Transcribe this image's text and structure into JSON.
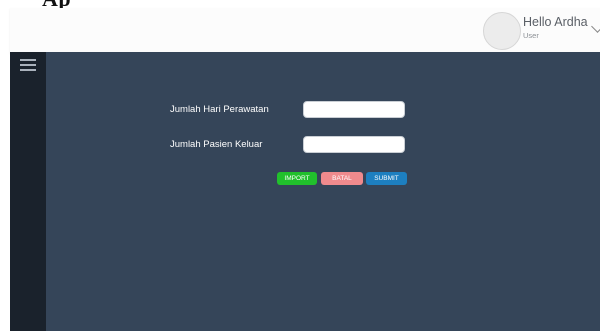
{
  "page": {
    "cut_title": "Ap"
  },
  "header": {
    "user_name": "Hello Ardha",
    "user_role": "User"
  },
  "form": {
    "field_1_label": "Jumlah Hari Perawatan",
    "field_1_value": "",
    "field_2_label": "Jumlah Pasien Keluar",
    "field_2_value": ""
  },
  "buttons": {
    "import_label": "IMPORT",
    "batal_label": "BATAL",
    "submit_label": "SUBMIT"
  },
  "colors": {
    "sidebar_bg": "#1a222c",
    "main_bg": "#354559",
    "import": "#21c02c",
    "batal": "#f08a8d",
    "submit": "#1d7fc0"
  },
  "icons": {
    "menu": "hamburger-icon",
    "user_menu": "chevron-down-icon",
    "avatar": "avatar-circle"
  }
}
